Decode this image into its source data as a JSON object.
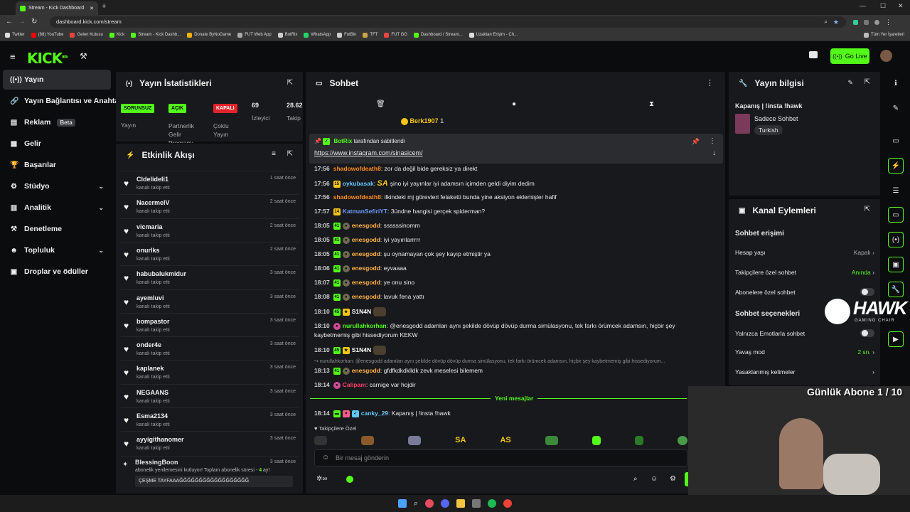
{
  "browser": {
    "tab_title": "Stream - Kick Dashboard",
    "url": "dashboard.kick.com/stream",
    "bookmarks": [
      "Twitter",
      "(88) YouTube",
      "Gelen Kutusu",
      "Kick",
      "Stream - Kick Dashb...",
      "Donate ByNoGame",
      "FUT Web App",
      "BotRix",
      "WhatsApp",
      "FutBin",
      "TFT",
      "FUT GG",
      "Dashboard / Stream...",
      "Uzaktan Erişim - Ch..."
    ],
    "all_bookmarks": "Tüm Yer İşaretleri"
  },
  "app": {
    "logo": "KICK",
    "logo_badge": "BETA",
    "go_live": "Go Live"
  },
  "sidebar": {
    "items": [
      {
        "label": "Yayın",
        "icon": "broadcast-icon"
      },
      {
        "label": "Yayın Bağlantısı ve Anahtarı",
        "icon": "link-icon"
      },
      {
        "label": "Reklam",
        "badge": "Beta",
        "icon": "ad-icon"
      },
      {
        "label": "Gelir",
        "icon": "revenue-icon"
      },
      {
        "label": "Başarılar",
        "icon": "trophy-icon"
      },
      {
        "label": "Stüdyo",
        "icon": "studio-icon"
      },
      {
        "label": "Analitik",
        "icon": "analytics-icon"
      },
      {
        "label": "Denetleme",
        "icon": "hammer-icon"
      },
      {
        "label": "Topluluk",
        "icon": "community-icon"
      },
      {
        "label": "Droplar ve ödüller",
        "icon": "gift-icon"
      }
    ]
  },
  "stats": {
    "title": "Yayın İstatistikleri",
    "cells": [
      {
        "badge": "SORUNSUZ",
        "label": "Yayın"
      },
      {
        "badge": "AÇIK",
        "label": "Partnerlik Gelir Programı"
      },
      {
        "badge": "KAPALI",
        "label": "Çoklu Yayın"
      },
      {
        "value": "69",
        "label": "İzleyici"
      },
      {
        "value": "28.62",
        "label": "Takip"
      }
    ]
  },
  "activity": {
    "title": "Etkinlik Akışı",
    "events": [
      {
        "name": "Cldelideli1",
        "sub": "kanalı takip etti",
        "time": "1 saat önce"
      },
      {
        "name": "NacermelV",
        "sub": "kanalı takip etti",
        "time": "2 saat önce"
      },
      {
        "name": "vicmaria",
        "sub": "kanalı takip etti",
        "time": "2 saat önce"
      },
      {
        "name": "onurlks",
        "sub": "kanalı takip etti",
        "time": "2 saat önce"
      },
      {
        "name": "habubalukmidur",
        "sub": "kanalı takip etti",
        "time": "3 saat önce"
      },
      {
        "name": "ayemluvi",
        "sub": "kanalı takip etti",
        "time": "3 saat önce"
      },
      {
        "name": "bompastor",
        "sub": "kanalı takip etti",
        "time": "3 saat önce"
      },
      {
        "name": "onder4e",
        "sub": "kanalı takip etti",
        "time": "3 saat önce"
      },
      {
        "name": "kaplanek",
        "sub": "kanalı takip etti",
        "time": "3 saat önce"
      },
      {
        "name": "NEGAANS",
        "sub": "kanalı takip etti",
        "time": "3 saat önce"
      },
      {
        "name": "Esma2134",
        "sub": "kanalı takip etti",
        "time": "3 saat önce"
      },
      {
        "name": "ayyigithanomer",
        "sub": "kanalı takip etti",
        "time": "3 saat önce"
      }
    ],
    "sub_event": {
      "name": "BlessingBoon",
      "time": "3 saat önce",
      "text": "abonelik yenilemesini kutluyor! Toplam abonelik süresi - ",
      "months": "4",
      "unit": " ay!",
      "message": "ÇEŞME TAYFAAAĞĞĞĞĞĞĞĞĞĞĞĞĞĞĞĞĞĞ"
    }
  },
  "chat": {
    "title": "Sohbet",
    "top_user": "Berk1907",
    "top_count": "1",
    "pinned_by": "BotRix",
    "pinned_label": "tarafından sabitlendi",
    "pinned_link": "https://www.instagram.com/sinasicem/",
    "messages": [
      {
        "time": "17:56",
        "user": "shadowofdeath8",
        "color": "#ff8c1a",
        "text": "zor da değil bide gereksiz ya direkt"
      },
      {
        "time": "17:56",
        "badge": "15",
        "badge_color": "#f5c518",
        "user": "oykubasak",
        "color": "#60c8ff",
        "emote": "SA",
        "text": "şino iyi yayınlar iyi adamsın içimden geldi diyim dedim"
      },
      {
        "time": "17:56",
        "user": "shadowofdeath8",
        "color": "#ff8c1a",
        "text": "ilkindeki mj görevleri felaketti bunda yine aksiyon eklemişler hafif"
      },
      {
        "time": "17:57",
        "badge": "14",
        "badge_color": "#f5c518",
        "user": "KatmanSefiriYT",
        "color": "#6f9bff",
        "text": "3ündne hangisi gerçek spiderman?"
      },
      {
        "time": "18:05",
        "badge": "41",
        "badge_color": "#53fc18",
        "user": "enesgodd",
        "color": "#ffb347",
        "text": "ssssssinomm"
      },
      {
        "time": "18:05",
        "badge": "41",
        "badge_color": "#53fc18",
        "user": "enesgodd",
        "color": "#ffb347",
        "text": "iyi yayınlarrrrr"
      },
      {
        "time": "18:05",
        "badge": "41",
        "badge_color": "#53fc18",
        "user": "enesgodd",
        "color": "#ffb347",
        "text": "şu oynamayan çok şey kayıp etmiştir ya"
      },
      {
        "time": "18:06",
        "badge": "41",
        "badge_color": "#53fc18",
        "user": "enesgodd",
        "color": "#ffb347",
        "text": "eyvaaaa"
      },
      {
        "time": "18:07",
        "badge": "41",
        "badge_color": "#53fc18",
        "user": "enesgodd",
        "color": "#ffb347",
        "text": "ye onu sino"
      },
      {
        "time": "18:08",
        "badge": "41",
        "badge_color": "#53fc18",
        "user": "enesgodd",
        "color": "#ffb347",
        "text": "lavuk fena yattı"
      },
      {
        "time": "18:10",
        "badge": "45",
        "badge_color": "#53fc18",
        "user": "S1N4N",
        "color": "#ffffff",
        "text": ""
      },
      {
        "time": "18:10",
        "user": "nurullahkorhan",
        "color": "#53fc18",
        "text": "@enesgodd adamları aynı şekilde dövüp dövüp durma simülasyonu, tek farkı örümcek adamsın, hiçbir şey",
        "text2": "kaybetmemiş gibi hissediyorum KEKW"
      },
      {
        "time": "18:10",
        "badge": "45",
        "badge_color": "#53fc18",
        "user": "S1N4N",
        "color": "#ffffff",
        "text": ""
      },
      {
        "reply": "nurullahkorhan: @enesgodd adamları aynı şekilde dövüp dövüp durma simülasyonu, tek farkı örümcek adamsın, hiçbir şey kaybetmemiş gibi hissediyorum..."
      },
      {
        "time": "18:13",
        "badge": "41",
        "badge_color": "#53fc18",
        "user": "enesgodd",
        "color": "#ffb347",
        "text": "gfdfkdkdklldk zevk meselesi bilemem"
      },
      {
        "time": "18:14",
        "user": "Calipam",
        "color": "#ff3b6b",
        "text": "carnige var hojdir"
      }
    ],
    "new_messages": "Yeni mesajlar",
    "last_message": {
      "time": "18:14",
      "user": "canky_29",
      "color": "#60c8ff",
      "text": "Kapanış | !insta !hawk"
    },
    "follower_only": "Takipçilere Özel",
    "input_placeholder": "Bir mesaj gönderin"
  },
  "stream_info": {
    "title": "Yayın bilgisi",
    "stream_title": "Kapanış | !insta !hawk",
    "category": "Sadece Sohbet",
    "language": "Turkish"
  },
  "channel_actions": {
    "title": "Kanal Eylemleri",
    "chat_access": "Sohbet erişimi",
    "rows": [
      {
        "label": "Hesap yaşı",
        "value": "Kapalı"
      },
      {
        "label": "Takipçilere özel sohbet",
        "value": "Anında"
      },
      {
        "label": "Abonelere özel sohbet",
        "value": ""
      }
    ],
    "chat_options": "Sohbet seçenekleri",
    "rows2": [
      {
        "label": "Yalnızca Emotlarla sohbet",
        "value": ""
      },
      {
        "label": "Yavaş mod",
        "value": "2 sn."
      },
      {
        "label": "Yasaklanmış kelimeler",
        "value": ""
      }
    ]
  },
  "overlay": {
    "hawk": "HAWK",
    "hawk_sub": "GAMING CHAIR",
    "sub_goal": "Günlük Abone 1 / 10"
  },
  "colors": {
    "accent": "#53fc18",
    "bg": "#0b0c0d",
    "panel": "#18191c"
  }
}
